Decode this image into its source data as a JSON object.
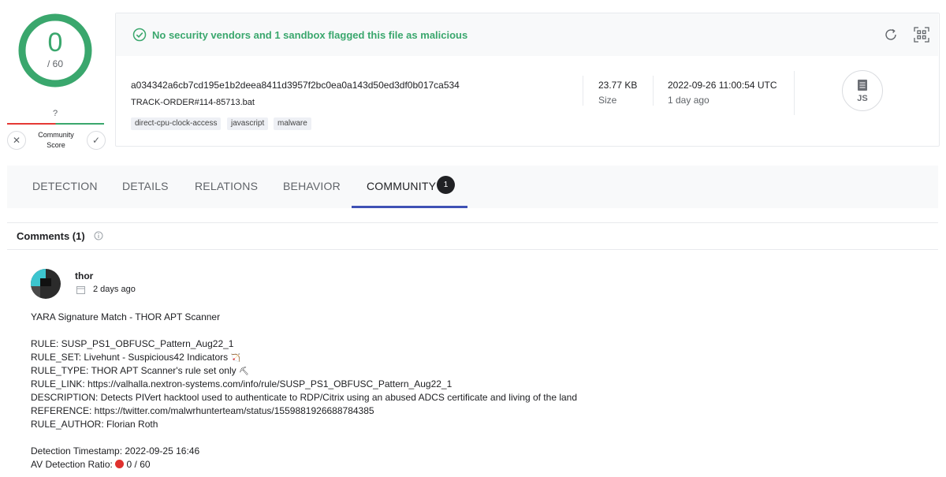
{
  "score": {
    "positives": "0",
    "total": "/ 60",
    "accent": "#3aa76d"
  },
  "community_score": {
    "value": "?",
    "label_line1": "Community",
    "label_line2": "Score",
    "dislike": "✕",
    "like": "✓"
  },
  "banner": {
    "text": "No security vendors and 1 sandbox flagged this file as malicious",
    "icon": "check-circle-icon",
    "color": "#3aa76d"
  },
  "file": {
    "sha256": "a034342a6cb7cd195e1b2deea8411d3957f2bc0ea0a143d50ed3df0b017ca534",
    "name": "TRACK-ORDER#114-85713.bat",
    "tags": [
      "direct-cpu-clock-access",
      "javascript",
      "malware"
    ],
    "size_value": "23.77 KB",
    "size_label": "Size",
    "date_value": "2022-09-26 11:00:54 UTC",
    "date_label": "1 day ago",
    "type_label": "JS"
  },
  "tabs": [
    {
      "label": "DETECTION"
    },
    {
      "label": "DETAILS"
    },
    {
      "label": "RELATIONS"
    },
    {
      "label": "BEHAVIOR"
    },
    {
      "label": "COMMUNITY",
      "badge": "1",
      "active": true
    }
  ],
  "comments": {
    "header": "Comments (1)",
    "items": [
      {
        "author": "thor",
        "posted": "2 days ago",
        "lines": [
          "YARA Signature Match - THOR APT Scanner",
          "RULE: SUSP_PS1_OBFUSC_Pattern_Aug22_1",
          "RULE_SET: Livehunt - Suspicious42 Indicators",
          "RULE_TYPE: THOR APT Scanner's rule set only",
          "RULE_LINK: https://valhalla.nextron-systems.com/info/rule/SUSP_PS1_OBFUSC_Pattern_Aug22_1",
          "DESCRIPTION: Detects PIVert hacktool used to authenticate to RDP/Citrix using an abused ADCS certificate and living of the land",
          "REFERENCE: https://twitter.com/malwrhunterteam/status/1559881926688784385",
          "RULE_AUTHOR: Florian Roth",
          "Detection Timestamp: 2022-09-25 16:46",
          "AV Detection Ratio: ",
          "0 / 60"
        ],
        "emoji_ruleset": "🏹",
        "emoji_ruletype": "⛏"
      }
    ]
  }
}
